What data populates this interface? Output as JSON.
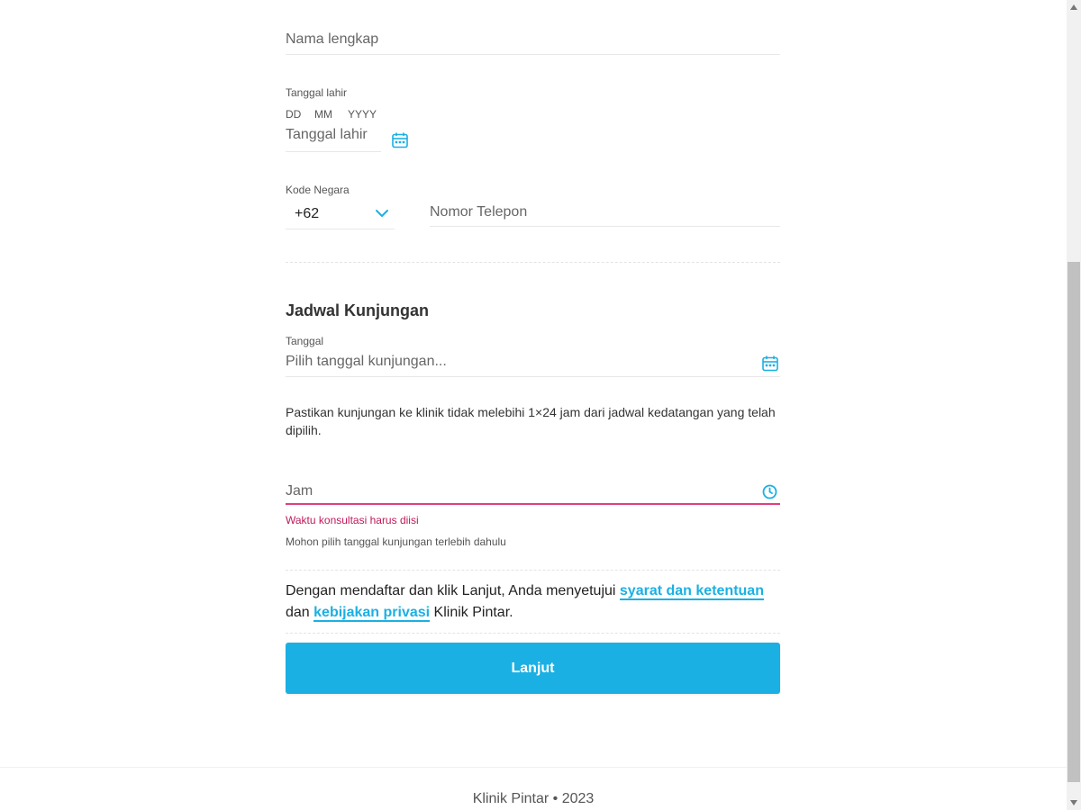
{
  "personal": {
    "fullname_placeholder": "Nama lengkap",
    "dob_label": "Tanggal lahir",
    "dob_mask_dd": "DD",
    "dob_mask_mm": "MM",
    "dob_mask_yyyy": "YYYY",
    "dob_placeholder": "Tanggal lahir",
    "country_code_label": "Kode Negara",
    "country_code_value": "+62",
    "phone_placeholder": "Nomor Telepon"
  },
  "visit": {
    "section_title": "Jadwal Kunjungan",
    "date_label": "Tanggal",
    "date_placeholder": "Pilih tanggal kunjungan...",
    "note": "Pastikan kunjungan ke klinik tidak melebihi 1×24 jam dari jadwal kedatangan yang telah dipilih.",
    "time_placeholder": "Jam",
    "time_error": "Waktu konsultasi harus diisi",
    "time_hint": "Mohon pilih tanggal kunjungan terlebih dahulu"
  },
  "consent": {
    "prefix": "Dengan mendaftar dan klik Lanjut, Anda menyetujui ",
    "terms_link": "syarat dan ketentuan",
    "middle": " dan ",
    "privacy_link": "kebijakan privasi",
    "suffix": " Klinik Pintar."
  },
  "submit_label": "Lanjut",
  "footer": {
    "text": "Klinik Pintar • 2023"
  },
  "colors": {
    "accent": "#1bb0e3",
    "error": "#c2185b",
    "error_line": "#e0407a"
  },
  "icons": {
    "dob": "calendar-icon",
    "visit_date": "calendar-icon",
    "time": "clock-icon",
    "country_code": "chevron-down-icon"
  }
}
